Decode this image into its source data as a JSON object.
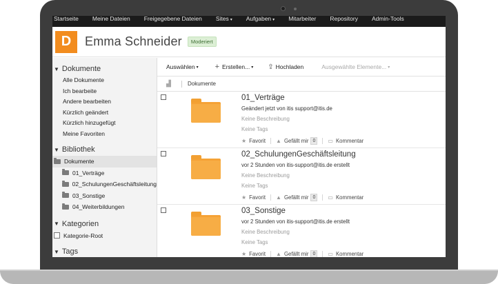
{
  "nav": {
    "items": [
      {
        "label": "Startseite"
      },
      {
        "label": "Meine Dateien"
      },
      {
        "label": "Freigegebene Dateien"
      },
      {
        "label": "Sites",
        "caret": "▾"
      },
      {
        "label": "Aufgaben",
        "caret": "▾"
      },
      {
        "label": "Mitarbeiter"
      },
      {
        "label": "Repository"
      },
      {
        "label": "Admin-Tools"
      }
    ]
  },
  "header": {
    "avatar_letter": "D",
    "user_name": "Emma Schneider",
    "badge": "Moderiert"
  },
  "sidebar": {
    "documents_title": "Dokumente",
    "documents_links": [
      "Alle Dokumente",
      "Ich bearbeite",
      "Andere bearbeiten",
      "Kürzlich geändert",
      "Kürzlich hinzugefügt",
      "Meine Favoriten"
    ],
    "library_title": "Bibliothek",
    "library_root": "Dokumente",
    "library_children": [
      "01_Verträge",
      "02_SchulungenGeschäftsleitung",
      "03_Sonstige",
      "04_Weiterbildungen"
    ],
    "categories_title": "Kategorien",
    "category_root": "Kategorie-Root",
    "tags_title": "Tags"
  },
  "toolbar": {
    "select_label": "Auswählen",
    "create_label": "Erstellen...",
    "upload_label": "Hochladen",
    "selected_items_label": "Ausgewählte Elemente..."
  },
  "list": {
    "column_header": "Dokumente",
    "favorite_label": "Favorit",
    "like_label": "Gefällt mir",
    "comment_label": "Kommentar",
    "rows": [
      {
        "name": "01_Verträge",
        "meta": "Geändert jetzt von itis support@itis.de",
        "description": "Keine Beschreibung",
        "tags": "Keine Tags",
        "likes": "0"
      },
      {
        "name": "02_SchulungenGeschäftsleitung",
        "meta": "vor 2 Stunden von itis-support@itis.de erstellt",
        "description": "Keine Beschreibung",
        "tags": "Keine Tags",
        "likes": "0"
      },
      {
        "name": "03_Sonstige",
        "meta": "vor 2 Stunden von itis-support@itis.de erstellt",
        "description": "Keine Beschreibung",
        "tags": "Keine Tags",
        "likes": "0"
      }
    ]
  },
  "icons": {
    "collapse": "triangle-down-icon",
    "folder": "folder-icon",
    "star": "star-icon",
    "thumb": "thumbs-up-icon",
    "comment": "comment-icon",
    "upload": "upload-icon",
    "plus": "plus-icon"
  },
  "colors": {
    "avatar": "#f28c1e",
    "folder": "#f5a236",
    "nav_bg": "#1b1b1b",
    "badge_bg": "#dcefd5"
  }
}
